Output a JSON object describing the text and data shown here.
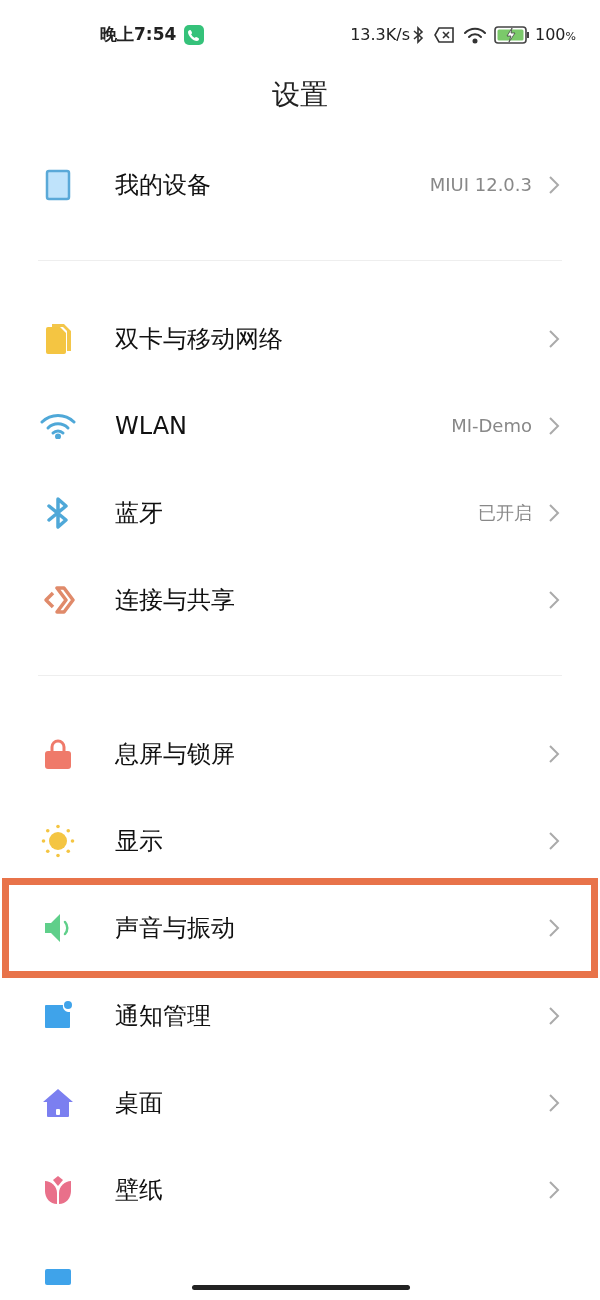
{
  "status_bar": {
    "time": "晚上7:54",
    "speed": "13.3K/s",
    "battery": "100",
    "battery_unit": "%"
  },
  "title": "设置",
  "groups": [
    {
      "items": [
        {
          "label": "我的设备",
          "value": "MIUI 12.0.3",
          "highlighted": false
        }
      ]
    },
    {
      "items": [
        {
          "label": "双卡与移动网络",
          "highlighted": false
        },
        {
          "label": "WLAN",
          "value": "MI-Demo",
          "highlighted": false
        },
        {
          "label": "蓝牙",
          "value": "已开启",
          "highlighted": false
        },
        {
          "label": "连接与共享",
          "highlighted": false
        }
      ]
    },
    {
      "items": [
        {
          "label": "息屏与锁屏",
          "highlighted": false
        },
        {
          "label": "显示",
          "highlighted": false
        },
        {
          "label": "声音与振动",
          "highlighted": true
        },
        {
          "label": "通知管理",
          "highlighted": false
        },
        {
          "label": "桌面",
          "highlighted": false
        },
        {
          "label": "壁纸",
          "highlighted": false
        },
        {
          "highlighted": false
        }
      ]
    }
  ]
}
